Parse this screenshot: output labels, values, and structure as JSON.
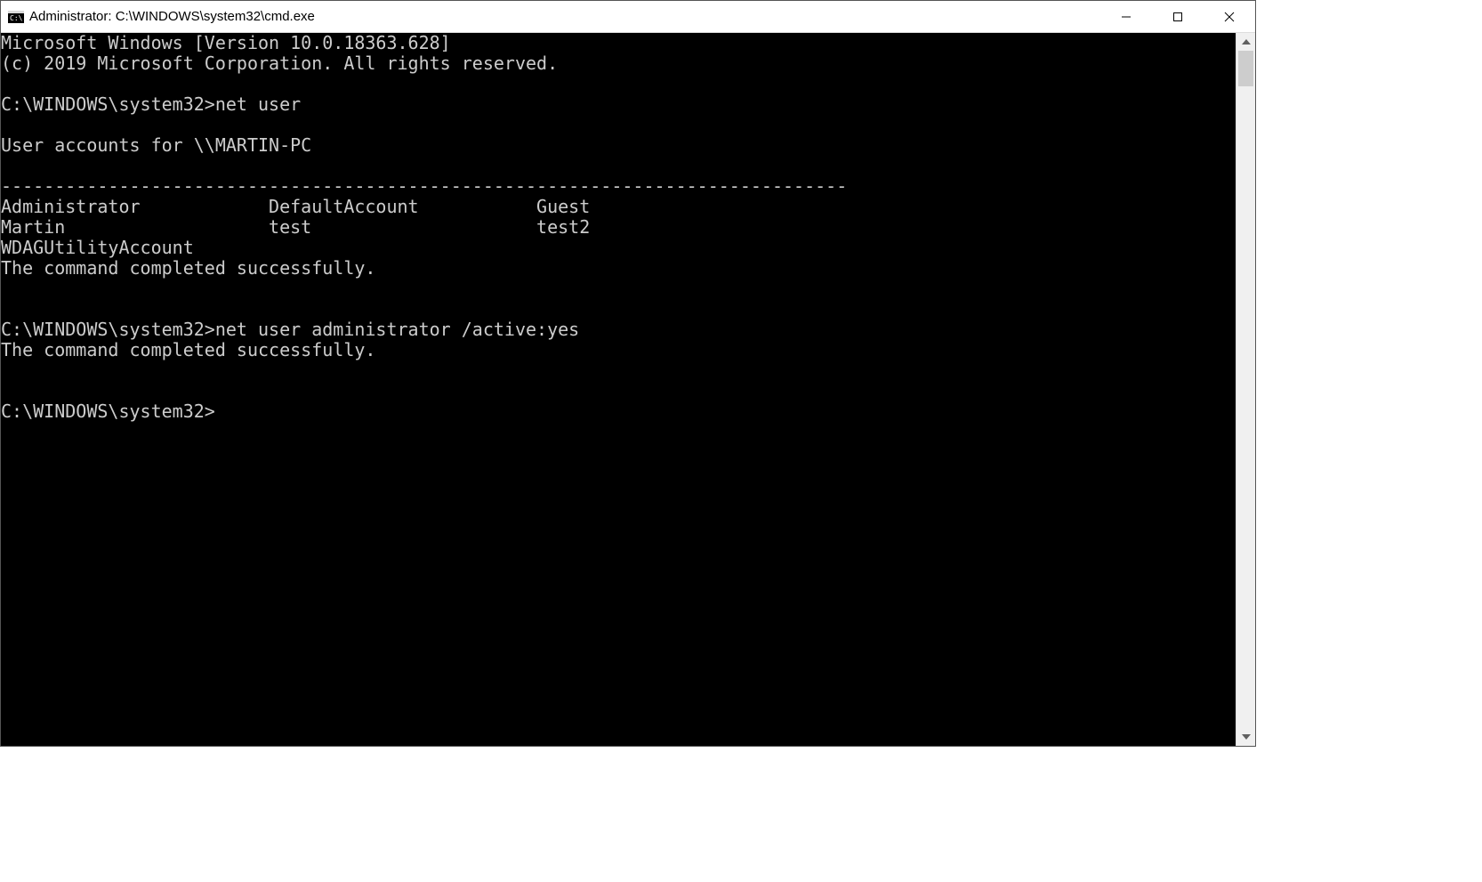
{
  "window": {
    "title": "Administrator: C:\\WINDOWS\\system32\\cmd.exe"
  },
  "console": {
    "banner_line1": "Microsoft Windows [Version 10.0.18363.628]",
    "banner_line2": "(c) 2019 Microsoft Corporation. All rights reserved.",
    "blank": "",
    "prompt1": "C:\\WINDOWS\\system32>",
    "cmd1": "net user",
    "netuser_header": "User accounts for \\\\MARTIN-PC",
    "separator": "-------------------------------------------------------------------------------",
    "accounts_row1_col1": "Administrator",
    "accounts_row1_col2": "DefaultAccount",
    "accounts_row1_col3": "Guest",
    "accounts_row2_col1": "Martin",
    "accounts_row2_col2": "test",
    "accounts_row2_col3": "test2",
    "accounts_row3_col1": "WDAGUtilityAccount",
    "success_msg": "The command completed successfully.",
    "prompt2": "C:\\WINDOWS\\system32>",
    "cmd2": "net user administrator /active:yes",
    "prompt3": "C:\\WINDOWS\\system32>"
  }
}
